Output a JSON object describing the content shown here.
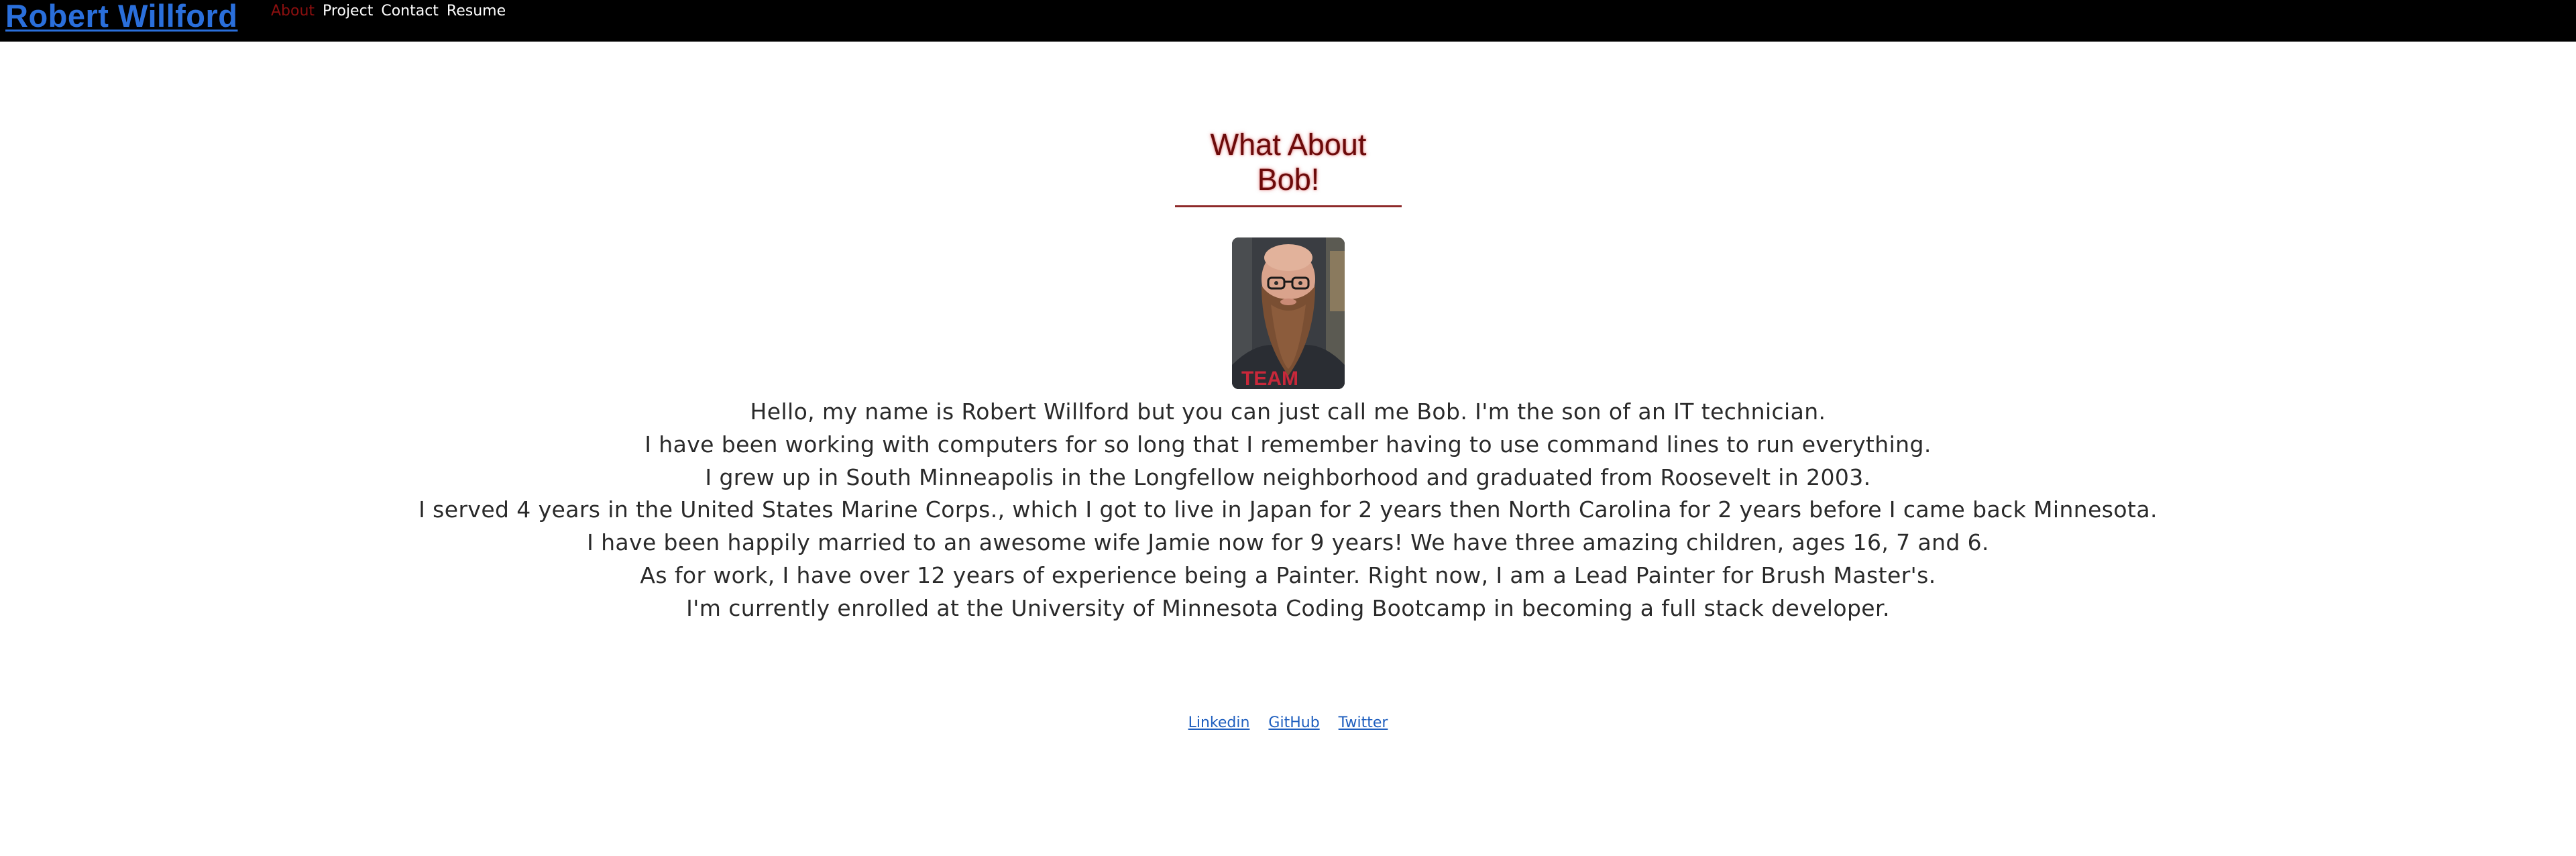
{
  "header": {
    "brand": "Robert Willford",
    "nav": [
      "About",
      "Project",
      "Contact",
      "Resume"
    ],
    "active_nav": "About"
  },
  "about": {
    "heading_line1": "What About",
    "heading_line2": "Bob!",
    "bio": [
      "Hello, my name is Robert Willford but you can just call me Bob. I'm the son of an IT technician.",
      "I have been working with computers for so long that I remember having to use command lines to run everything.",
      "I grew up in South Minneapolis in the Longfellow neighborhood and graduated from Roosevelt in 2003.",
      "I served 4 years in the United States Marine Corps., which I got to live in Japan for 2 years then North Carolina for 2 years before I came back Minnesota.",
      "I have been happily married to an awesome wife Jamie now for 9 years! We have three amazing children, ages 16, 7 and 6.",
      "As for work, I have over 12 years of experience being a Painter. Right now, I am a Lead Painter for Brush Master's.",
      "I'm currently enrolled at the University of Minnesota Coding Bootcamp in becoming a full stack developer."
    ]
  },
  "footer": {
    "links": [
      "Linkedin",
      "GitHub",
      "Twitter"
    ]
  },
  "colors": {
    "navbar_bg": "#000000",
    "brand": "#2a6fdb",
    "active_nav": "#8b0f0f",
    "heading": "#6b0a0a",
    "footer_link": "#1f5fbf"
  }
}
